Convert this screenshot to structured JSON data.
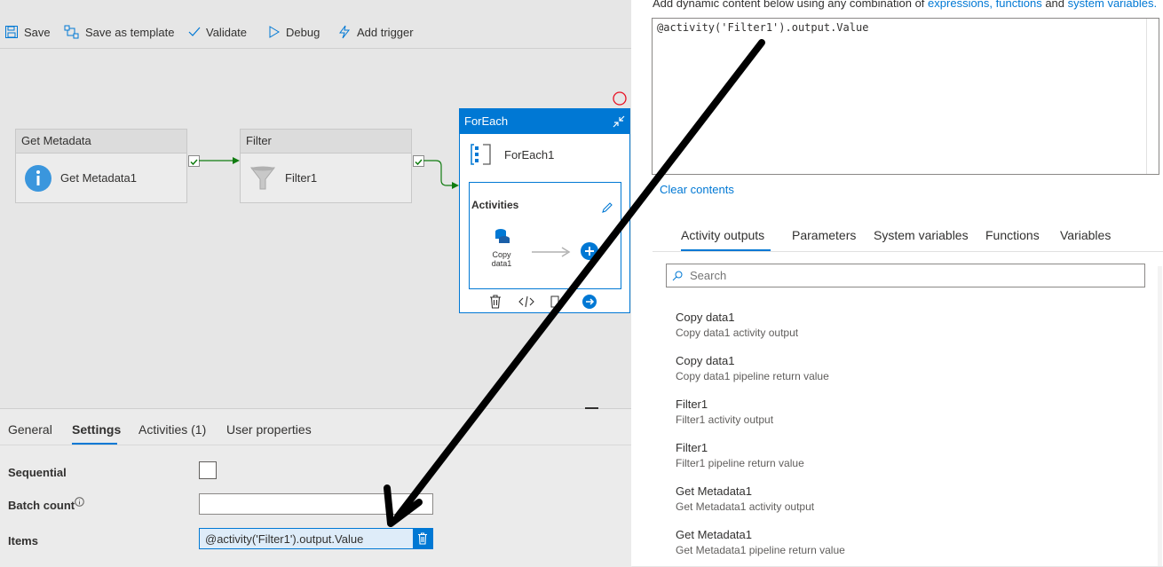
{
  "toolbar": {
    "save": "Save",
    "save_template": "Save as template",
    "validate": "Validate",
    "debug": "Debug",
    "add_trigger": "Add trigger"
  },
  "nodes": {
    "get_metadata": {
      "type": "Get Metadata",
      "name": "Get Metadata1"
    },
    "filter": {
      "type": "Filter",
      "name": "Filter1"
    },
    "foreach": {
      "type": "ForEach",
      "name": "ForEach1",
      "activities_label": "Activities",
      "inner_activity": [
        "Copy",
        "data1"
      ]
    }
  },
  "bottom_tabs": [
    "General",
    "Settings",
    "Activities (1)",
    "User properties"
  ],
  "settings": {
    "sequential_label": "Sequential",
    "batch_count_label": "Batch count",
    "items_label": "Items",
    "items_value": "@activity('Filter1').output.Value"
  },
  "expression": {
    "hint_prefix": "Add dynamic content below using any combination of",
    "hint_link1": "expressions,",
    "hint_link2": "functions",
    "hint_and": "and",
    "hint_link3": "system variables.",
    "value": "@activity('Filter1').output.Value",
    "clear": "Clear contents"
  },
  "right_tabs": [
    "Activity outputs",
    "Parameters",
    "System variables",
    "Functions",
    "Variables"
  ],
  "search": {
    "placeholder": "Search"
  },
  "outputs": [
    {
      "title": "Copy data1",
      "subtitle": "Copy data1 activity output"
    },
    {
      "title": "Copy data1",
      "subtitle": "Copy data1 pipeline return value"
    },
    {
      "title": "Filter1",
      "subtitle": "Filter1 activity output"
    },
    {
      "title": "Filter1",
      "subtitle": "Filter1 pipeline return value"
    },
    {
      "title": "Get Metadata1",
      "subtitle": "Get Metadata1 activity output"
    },
    {
      "title": "Get Metadata1",
      "subtitle": "Get Metadata1 pipeline return value"
    }
  ],
  "colors": {
    "accent": "#0078d4",
    "success": "#107c10",
    "error": "#e81123"
  }
}
